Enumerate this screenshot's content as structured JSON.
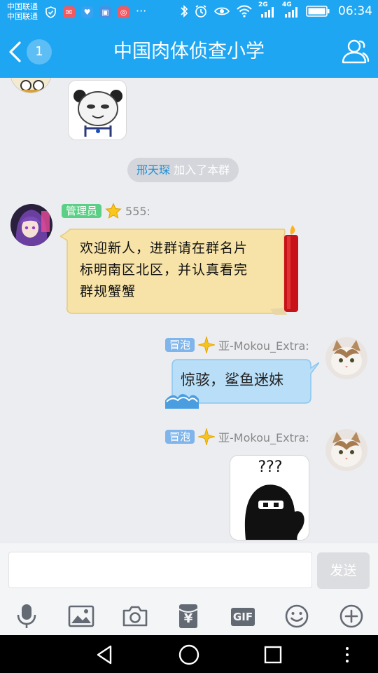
{
  "status_bar": {
    "carrier_1": "中国联通",
    "carrier_2": "中国联通",
    "network_1": "2G",
    "network_2": "4G",
    "time": "06:34",
    "icons": [
      "shield-icon",
      "mail-icon",
      "health-icon",
      "gallery-icon",
      "weibo-icon",
      "more-dots-icon",
      "bluetooth-icon",
      "alarm-icon",
      "eye-icon",
      "wifi-icon",
      "signal-icon",
      "battery-icon"
    ]
  },
  "header": {
    "title": "中国肉体侦查小学",
    "unread_count": "1",
    "back_icon": "chevron-left-icon",
    "group_icon": "group-members-icon"
  },
  "messages": {
    "system_notice": {
      "member_name": "邢天琛",
      "text": "加入了本群"
    },
    "admin_message": {
      "badge": "管理员",
      "star_icon": "star-icon",
      "sender": "555:",
      "text_line_1": "欢迎新人，进群请在群名片",
      "text_line_2": "标明南区北区，并认真看完",
      "text_line_3": "群规蟹蟹"
    },
    "self_message_1": {
      "badge": "冒泡",
      "sparkle_icon": "sparkle-icon",
      "sender": "亚-Mokou_Extra:",
      "text": "惊骇，鲨鱼迷妹"
    },
    "self_message_2": {
      "badge": "冒泡",
      "sparkle_icon": "sparkle-icon",
      "sender": "亚-Mokou_Extra:",
      "sticker_text": "???"
    }
  },
  "input": {
    "value": "",
    "placeholder": "",
    "send_label": "发送"
  },
  "toolbar": {
    "items": [
      "microphone-icon",
      "image-icon",
      "camera-icon",
      "red-packet-icon",
      "gif-icon",
      "emoji-icon",
      "plus-icon"
    ],
    "gif_label": "GIF",
    "red_packet_symbol": "¥"
  },
  "colors": {
    "accent": "#1fa6f2",
    "background": "#ecedf1",
    "admin_badge": "#5bcf85",
    "bubble_badge": "#7fb5ea"
  }
}
